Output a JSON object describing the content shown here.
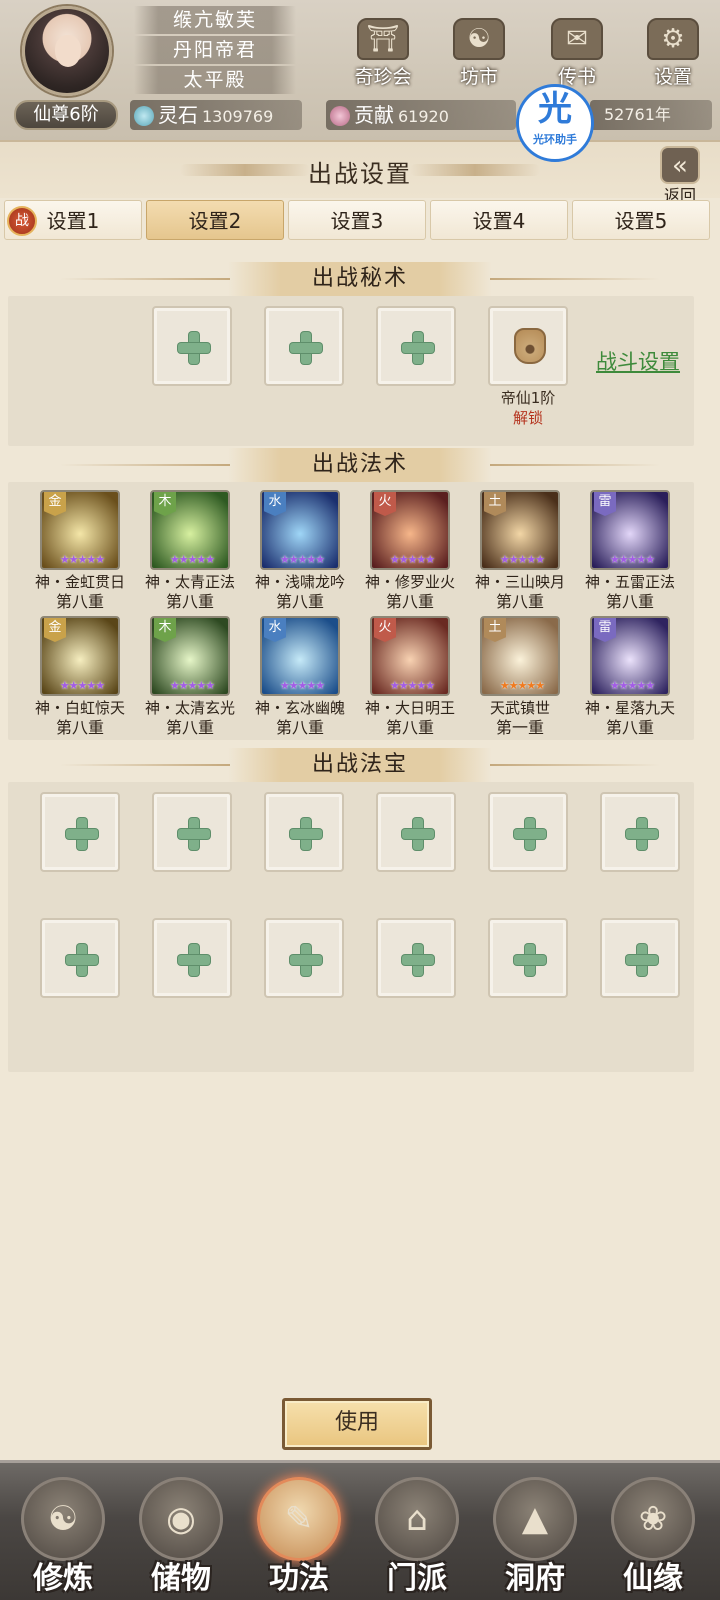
{
  "header": {
    "rank": "仙尊6阶",
    "names": [
      "缑亢敏芙",
      "丹阳帝君",
      "太平殿"
    ],
    "spirit_stone": {
      "label": "灵石",
      "value": "1309769"
    },
    "contribution": {
      "label": "贡献",
      "value": "61920"
    },
    "years": "52761年",
    "buttons": [
      "奇珍会",
      "坊市",
      "传书",
      "设置"
    ],
    "assistant": {
      "glyph": "光",
      "label": "光环助手"
    }
  },
  "panel": {
    "title": "出战设置",
    "back_label": "返回",
    "tabs": [
      {
        "label": "设置1",
        "badge": "战"
      },
      {
        "label": "设置2"
      },
      {
        "label": "设置3"
      },
      {
        "label": "设置4"
      },
      {
        "label": "设置5"
      }
    ],
    "secret_section": {
      "title": "出战秘术",
      "locked": {
        "line1": "帝仙1阶",
        "line2": "解锁"
      },
      "battle_settings": "战斗设置"
    },
    "spell_section": {
      "title": "出战法术",
      "skills": [
        {
          "element": "金",
          "name": "神・金虹贯日",
          "tier": "第八重",
          "elcolor": "#c9a24a",
          "c1": "#f4e6a8",
          "c2": "#6a4f1c",
          "stars": "★★★★★"
        },
        {
          "element": "木",
          "name": "神・太青正法",
          "tier": "第八重",
          "elcolor": "#6ea24a",
          "c1": "#d7f0a0",
          "c2": "#2e5a22",
          "stars": "★★★★★"
        },
        {
          "element": "水",
          "name": "神・浅啸龙吟",
          "tier": "第八重",
          "elcolor": "#4a7fc0",
          "c1": "#9fd6f7",
          "c2": "#1b2f6e",
          "stars": "★★★★★"
        },
        {
          "element": "火",
          "name": "神・修罗业火",
          "tier": "第八重",
          "elcolor": "#c05a4a",
          "c1": "#f6b68a",
          "c2": "#5a1f1f",
          "stars": "★★★★★"
        },
        {
          "element": "土",
          "name": "神・三山映月",
          "tier": "第八重",
          "elcolor": "#b08a5a",
          "c1": "#f2d6a6",
          "c2": "#4a2f1a",
          "stars": "★★★★★"
        },
        {
          "element": "雷",
          "name": "神・五雷正法",
          "tier": "第八重",
          "elcolor": "#7a6ac0",
          "c1": "#e2d6f8",
          "c2": "#2a1f5a",
          "stars": "★★★★★"
        },
        {
          "element": "金",
          "name": "神・白虹惊天",
          "tier": "第八重",
          "elcolor": "#c9a24a",
          "c1": "#f6eec0",
          "c2": "#5a4618",
          "stars": "★★★★★"
        },
        {
          "element": "木",
          "name": "神・太清玄光",
          "tier": "第八重",
          "elcolor": "#6ea24a",
          "c1": "#e6f6c8",
          "c2": "#2e4a22",
          "stars": "★★★★★"
        },
        {
          "element": "水",
          "name": "神・玄冰幽魄",
          "tier": "第八重",
          "elcolor": "#4a7fc0",
          "c1": "#c6eaf8",
          "c2": "#1c4e8a",
          "stars": "★★★★★"
        },
        {
          "element": "火",
          "name": "神・大日明王",
          "tier": "第八重",
          "elcolor": "#c05a4a",
          "c1": "#f8d2b2",
          "c2": "#6a2a22",
          "stars": "★★★★★"
        },
        {
          "element": "土",
          "name": "天武镇世",
          "tier": "第一重",
          "elcolor": "#b08a5a",
          "c1": "#fbf2da",
          "c2": "#8a6a4a",
          "stars": "★★★★★",
          "orange": true
        },
        {
          "element": "雷",
          "name": "神・星落九天",
          "tier": "第八重",
          "elcolor": "#7a6ac0",
          "c1": "#ebe2fb",
          "c2": "#2f2460",
          "stars": "★★★★★"
        }
      ]
    },
    "treasure_section": {
      "title": "出战法宝"
    },
    "use_button": "使用"
  },
  "bottom_nav": [
    {
      "label": "修炼",
      "glyph": "☯"
    },
    {
      "label": "储物",
      "glyph": "◉"
    },
    {
      "label": "功法",
      "glyph": "✎",
      "active": true
    },
    {
      "label": "门派",
      "glyph": "⌂"
    },
    {
      "label": "洞府",
      "glyph": "▲"
    },
    {
      "label": "仙缘",
      "glyph": "❀"
    }
  ]
}
